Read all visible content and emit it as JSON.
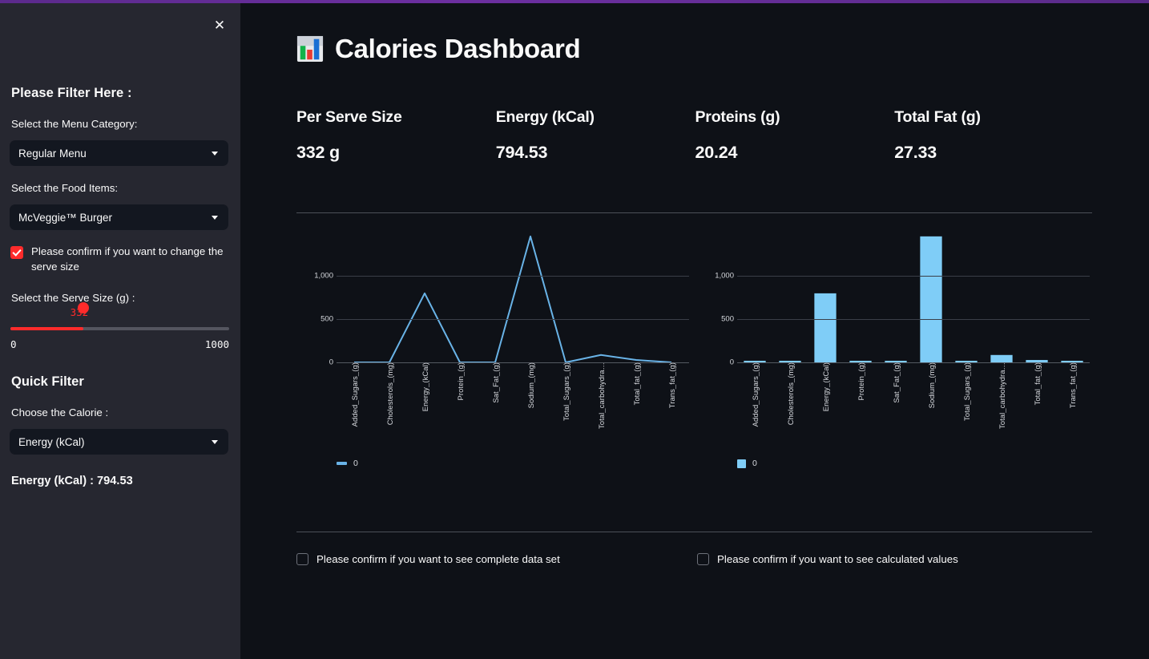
{
  "top_accent_color": "#5b2a8c",
  "sidebar": {
    "close_icon": "close-icon",
    "title": "Please Filter Here :",
    "menu_category_label": "Select the Menu Category:",
    "menu_category_value": "Regular Menu",
    "food_items_label": "Select the Food Items:",
    "food_items_value": "McVeggie™ Burger",
    "confirm_serve_size_text": "Please confirm if you want to change the serve size",
    "confirm_serve_size_checked": true,
    "serve_size_label": "Select the Serve Size (g) :",
    "serve_size_value": "332",
    "serve_size_min": "0",
    "serve_size_max": "1000",
    "serve_size_percent": 33.2,
    "slider_color": "#ff2b2b",
    "quick_filter_title": "Quick Filter",
    "choose_calorie_label": "Choose the Calorie :",
    "choose_calorie_value": "Energy (kCal)",
    "result_text": "Energy (kCal) : 794.53"
  },
  "main": {
    "title": "Calories Dashboard",
    "title_icon": "bar-chart-icon",
    "metrics": [
      {
        "label": "Per Serve Size",
        "value": "332 g"
      },
      {
        "label": "Energy (kCal)",
        "value": "794.53"
      },
      {
        "label": "Proteins (g)",
        "value": "20.24"
      },
      {
        "label": "Total Fat (g)",
        "value": "27.33"
      }
    ],
    "bottom_checkboxes": [
      {
        "label": "Please confirm if you want to see complete data set",
        "checked": false
      },
      {
        "label": "Please confirm if you want to see calculated values",
        "checked": false
      }
    ]
  },
  "chart_data": [
    {
      "type": "line",
      "title": "",
      "xlabel": "",
      "ylabel": "",
      "categories": [
        "Added_Sugars_(g)",
        "Cholesterols_(mg)",
        "Energy_(kCal)",
        "Protein_(g)",
        "Sat_Fat_(g)",
        "Sodium_(mg)",
        "Total_Sugars_(g)",
        "Total_carbohydra…",
        "Total_fat_(g)",
        "Trans_fat_(g)"
      ],
      "series": [
        {
          "name": "0",
          "values": [
            0,
            0,
            794.53,
            0,
            0,
            1450,
            0,
            85,
            27.33,
            0
          ]
        }
      ],
      "yticks": [
        0,
        500,
        1000
      ],
      "ytick_labels": [
        "0",
        "500",
        "1,000"
      ],
      "ylim": [
        0,
        1550
      ],
      "grid": true,
      "legend": [
        "0"
      ],
      "legend_position": "bottom-left",
      "color": "#69b3e7"
    },
    {
      "type": "bar",
      "title": "",
      "xlabel": "",
      "ylabel": "",
      "categories": [
        "Added_Sugars_(g)",
        "Cholesterols_(mg)",
        "Energy_(kCal)",
        "Protein_(g)",
        "Sat_Fat_(g)",
        "Sodium_(mg)",
        "Total_Sugars_(g)",
        "Total_carbohydra…",
        "Total_fat_(g)",
        "Trans_fat_(g)"
      ],
      "series": [
        {
          "name": "0",
          "values": [
            2,
            2,
            794.53,
            8,
            5,
            1450,
            6,
            85,
            27.33,
            1
          ]
        }
      ],
      "yticks": [
        0,
        500,
        1000
      ],
      "ytick_labels": [
        "0",
        "500",
        "1,000"
      ],
      "ylim": [
        0,
        1550
      ],
      "grid": true,
      "legend": [
        "0"
      ],
      "legend_position": "bottom-left",
      "color": "#7fcdf7"
    }
  ]
}
